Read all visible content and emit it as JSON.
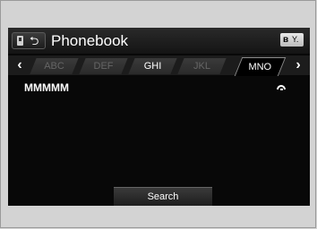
{
  "header": {
    "title": "Phonebook",
    "back_icon": "back-arrow-icon",
    "phone_icon": "phone-icon",
    "bluetooth_icon": "bluetooth-icon",
    "signal_icon": "signal-icon",
    "bluetooth_glyph": "ʙ",
    "signal_glyph": "Y."
  },
  "tabs": {
    "items": [
      {
        "label": "ABC",
        "state": "dim"
      },
      {
        "label": "DEF",
        "state": "dim"
      },
      {
        "label": "GHI",
        "state": "normal"
      },
      {
        "label": "JKL",
        "state": "dim"
      },
      {
        "label": "MNO",
        "state": "active"
      }
    ],
    "prev_glyph": "‹",
    "next_glyph": "›"
  },
  "contacts": [
    {
      "name": "MMMMM",
      "type_icon": "phone-handset-icon"
    }
  ],
  "footer": {
    "search_label": "Search"
  },
  "colors": {
    "screen_bg": "#080808",
    "outer_bg": "#d3d3d3",
    "text": "#ffffff",
    "dim_text": "#666666"
  }
}
